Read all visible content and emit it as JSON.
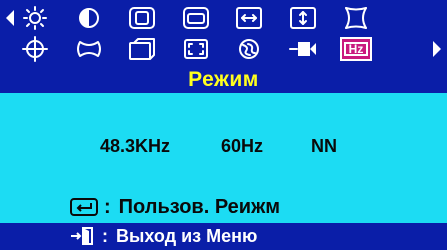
{
  "menu": {
    "title": "Режим",
    "selected_icon": "hz-frequency-icon",
    "hz_label": "Hz",
    "row1_icons": [
      "brightness-icon",
      "contrast-icon",
      "h-size-icon",
      "v-size-icon",
      "h-position-icon",
      "v-position-icon",
      "pincushion-icon"
    ],
    "row2_icons": [
      "geometry-icon",
      "trapezoid-icon",
      "parallelogram-icon",
      "tilt-icon",
      "degauss-icon",
      "input-icon",
      "hz-frequency-icon"
    ]
  },
  "signal": {
    "h_freq": "48.3KHz",
    "v_freq": "60Hz",
    "polarity": "NN"
  },
  "footer": {
    "enter_hint_colon": ":",
    "enter_hint": "Пользов. Реижм",
    "exit_hint_colon": ":",
    "exit_hint": "Выход из Меню"
  },
  "colors": {
    "background": "#0a1ea8",
    "panel": "#1cdcf3",
    "title": "#ffff1e",
    "selected": "#c9197e"
  }
}
